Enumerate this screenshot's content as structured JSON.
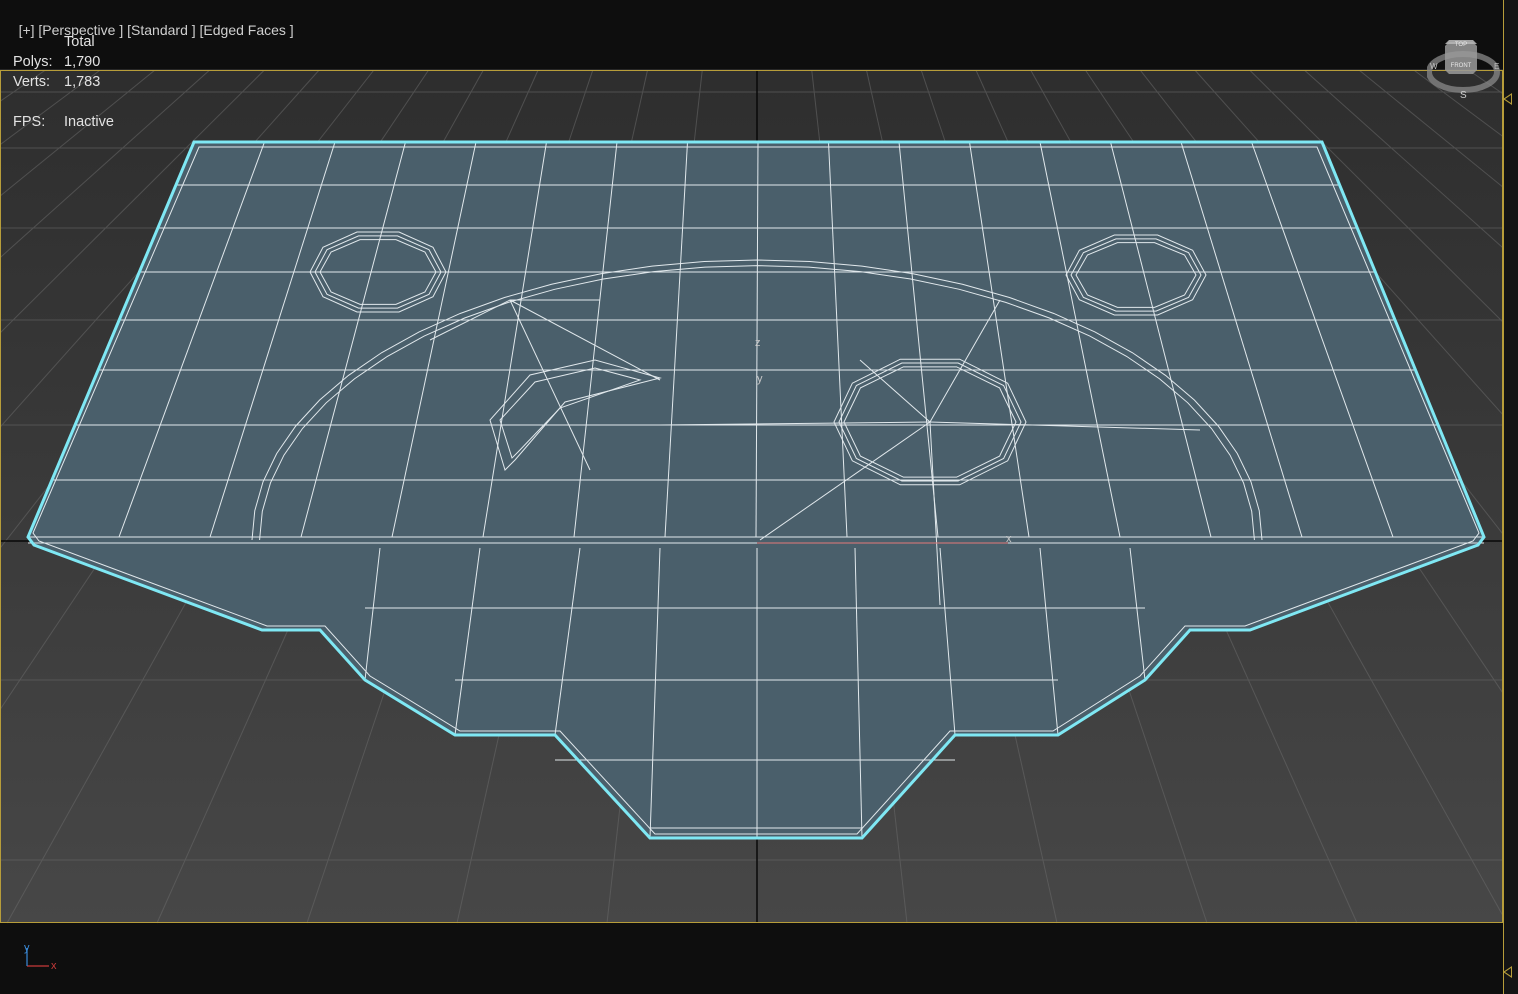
{
  "viewport": {
    "menu": {
      "plus": "[+]",
      "view": "[Perspective ]",
      "shading": "[Standard ]",
      "display": "[Edged Faces ]"
    },
    "stats": {
      "header": "Total",
      "polys_label": "Polys:",
      "polys_value": "1,790",
      "verts_label": "Verts:",
      "verts_value": "1,783",
      "fps_label": "FPS:",
      "fps_value": "Inactive"
    },
    "viewcube": {
      "top": "TOP",
      "front": "FRONT",
      "west": "W",
      "east": "E",
      "south": "S"
    },
    "axis_labels": {
      "z": "z",
      "y": "y",
      "x": "x"
    },
    "triad": {
      "y": "y",
      "x": "x"
    }
  },
  "colors": {
    "background_top": "#111111",
    "grid_floor": "#3c3c3c",
    "grid_line": "#6a6a6a",
    "mesh_fill": "#4a5f6b",
    "mesh_wire": "#eef4f7",
    "selection_outline": "#7fe8f4",
    "frame": "#b79d3a",
    "x_axis": "#c83a3a",
    "y_axis": "#3a8ad8"
  }
}
